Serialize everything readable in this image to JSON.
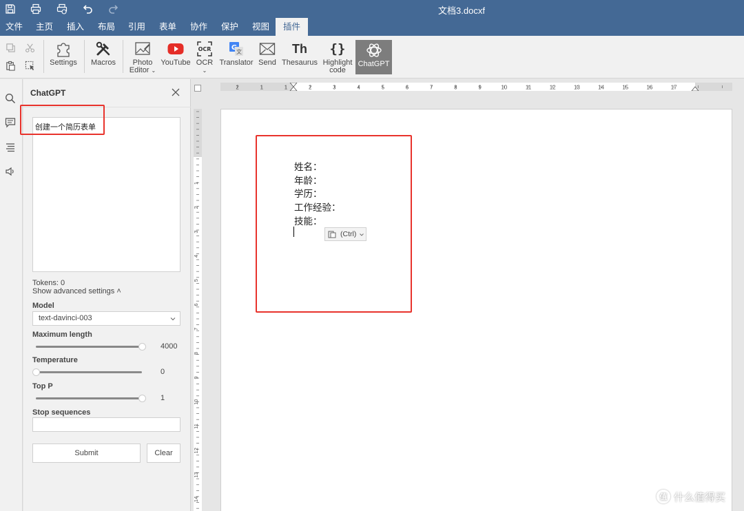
{
  "window": {
    "doc_title": "文档3.docxf"
  },
  "menu": {
    "items": [
      {
        "label": "文件"
      },
      {
        "label": "主页"
      },
      {
        "label": "插入"
      },
      {
        "label": "布局"
      },
      {
        "label": "引用"
      },
      {
        "label": "表单"
      },
      {
        "label": "协作"
      },
      {
        "label": "保护"
      },
      {
        "label": "视图"
      },
      {
        "label": "插件"
      }
    ],
    "active_index": 9
  },
  "ribbon": {
    "buttons": [
      {
        "label": "Settings",
        "icon": "puzzle-icon"
      },
      {
        "label": "Macros",
        "icon": "tools-icon"
      },
      {
        "label": "Photo Editor",
        "icon": "image-edit-icon"
      },
      {
        "label": "YouTube",
        "icon": "youtube-icon"
      },
      {
        "label": "OCR",
        "icon": "ocr-icon"
      },
      {
        "label": "Translator",
        "icon": "translate-icon"
      },
      {
        "label": "Send",
        "icon": "mail-icon"
      },
      {
        "label": "Thesaurus",
        "icon": "thesaurus-icon",
        "glyph": "Th"
      },
      {
        "label": "Highlight code",
        "icon": "braces-icon",
        "glyph": "{}"
      },
      {
        "label": "ChatGPT",
        "icon": "openai-icon"
      }
    ],
    "active_index": 9,
    "photo_label": [
      "Photo",
      "Editor"
    ],
    "highlight_label": [
      "Highlight",
      "code"
    ]
  },
  "panel": {
    "title": "ChatGPT",
    "prompt": "创建一个简历表单",
    "tokens": "Tokens: 0",
    "advanced": "Show advanced settings",
    "model_label": "Model",
    "model_value": "text-davinci-003",
    "maxlen_label": "Maximum length",
    "maxlen_value": "4000",
    "maxlen_fraction": 1.0,
    "temp_label": "Temperature",
    "temp_value": "0",
    "temp_fraction": 0.0,
    "topp_label": "Top P",
    "topp_value": "1",
    "topp_fraction": 1.0,
    "stop_label": "Stop sequences",
    "submit": "Submit",
    "clear": "Clear"
  },
  "document": {
    "lines": [
      "姓名：",
      "年龄：",
      "学历：",
      "工作经验：",
      "技能："
    ],
    "paste_label": "(Ctrl)"
  },
  "ruler": {
    "h_numbers": [
      "2",
      "1",
      "1",
      "2",
      "3",
      "4",
      "5",
      "6",
      "7",
      "8",
      "9",
      "10",
      "11",
      "12",
      "13",
      "14",
      "15",
      "16",
      "17"
    ],
    "v_numbers": [
      "1",
      "2",
      "3",
      "4",
      "5",
      "6",
      "7",
      "8",
      "9",
      "10",
      "11",
      "12",
      "13",
      "14"
    ]
  },
  "watermark": {
    "text": "什么值得买",
    "logo": "值"
  },
  "colors": {
    "titlebar": "#446995",
    "highlight_red": "#e8322b",
    "active_button": "#7d7d7d"
  }
}
